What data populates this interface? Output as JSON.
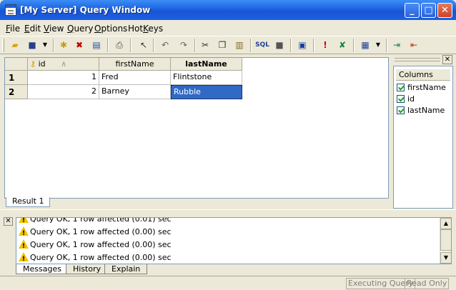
{
  "window": {
    "title": "[My Server] Query Window",
    "minimize_glyph": "_",
    "maximize_glyph": "□",
    "close_glyph": "✕"
  },
  "menu": {
    "items": [
      {
        "label": "File",
        "mnemonic": "F",
        "rest": "ile"
      },
      {
        "label": "Edit",
        "mnemonic": "E",
        "rest": "dit"
      },
      {
        "label": "View",
        "mnemonic": "V",
        "rest": "iew"
      },
      {
        "label": "Query",
        "mnemonic": "Q",
        "rest": "uery"
      },
      {
        "label": "Options",
        "mnemonic": "O",
        "rest": "ptions"
      },
      {
        "label": "HotKeys",
        "mnemonic": "K",
        "pre": "Hot",
        "rest": "eys"
      }
    ]
  },
  "toolbar": {
    "sql_label": "SQL",
    "icons": [
      "open-folder-icon",
      "save-disk-icon",
      "dropdown-arrow-icon",
      "new-row-icon",
      "delete-row-icon",
      "refresh-table-icon",
      "print-icon",
      "pointer-icon",
      "undo-icon",
      "redo-icon",
      "cut-icon",
      "copy-icon",
      "paste-icon",
      "sql-icon",
      "stop-icon",
      "page-icon",
      "execute-icon",
      "cancel-icon",
      "grid-view-icon",
      "import-icon",
      "export-icon"
    ]
  },
  "grid": {
    "columns": [
      {
        "label": "id",
        "key_icon": "key-icon",
        "sort_glyph": "∧"
      },
      {
        "label": "firstName"
      },
      {
        "label": "lastName",
        "bold": true
      }
    ],
    "rows": [
      {
        "row_no": "1",
        "id": "1",
        "firstName": "Fred",
        "lastName": "Flintstone"
      },
      {
        "row_no": "2",
        "id": "2",
        "firstName": "Barney",
        "lastName": "Rubble"
      }
    ],
    "result_tab": "Result 1"
  },
  "columns_panel": {
    "header": "Columns",
    "close_glyph": "✕",
    "items": [
      {
        "label": "firstName",
        "checked": true
      },
      {
        "label": "id",
        "checked": true
      },
      {
        "label": "lastName",
        "checked": true
      }
    ]
  },
  "messages": {
    "close_glyph": "✕",
    "lines": [
      "Query OK, 1 row affected (0.01) sec",
      "Query OK, 1 row affected (0.00) sec",
      "Query OK, 1 row affected (0.00) sec",
      "Query OK, 1 row affected (0.00) sec"
    ],
    "tabs": [
      "Messages",
      "History",
      "Explain"
    ]
  },
  "status": {
    "executing": "Executing Query",
    "mode": "Read Only"
  },
  "colors": {
    "title_blue": "#1d5ee3",
    "selection": "#316ac5",
    "chrome": "#ece9d8"
  }
}
